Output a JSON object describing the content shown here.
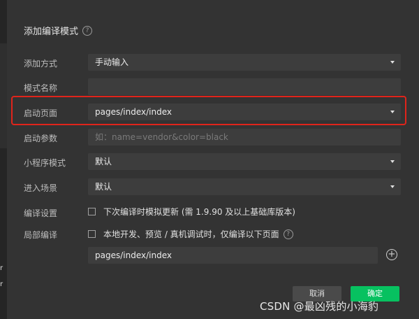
{
  "dialog": {
    "title": "添加编译模式",
    "fields": {
      "add_method": {
        "label": "添加方式",
        "value": "手动输入"
      },
      "mode_name": {
        "label": "模式名称",
        "value": ""
      },
      "start_page": {
        "label": "启动页面",
        "value": "pages/index/index"
      },
      "start_params": {
        "label": "启动参数",
        "placeholder": "如：name=vendor&color=black"
      },
      "miniprogram_mode": {
        "label": "小程序模式",
        "value": "默认"
      },
      "scene": {
        "label": "进入场景",
        "value": "默认"
      },
      "compile_settings": {
        "label": "编译设置",
        "checkbox_text": "下次编译时模拟更新 (需 1.9.90 及以上基础库版本)"
      },
      "partial_compile": {
        "label": "局部编译",
        "checkbox_text": "本地开发、预览 / 真机调试时，仅编译以下页面",
        "page": "pages/index/index"
      }
    },
    "buttons": {
      "cancel": "取消",
      "ok": "确定"
    }
  },
  "bg_sliver": [
    "r",
    "r"
  ],
  "watermark": "CSDN @最凶残的小海豹",
  "colors": {
    "primary": "#07c160",
    "highlight": "#e0241b"
  }
}
